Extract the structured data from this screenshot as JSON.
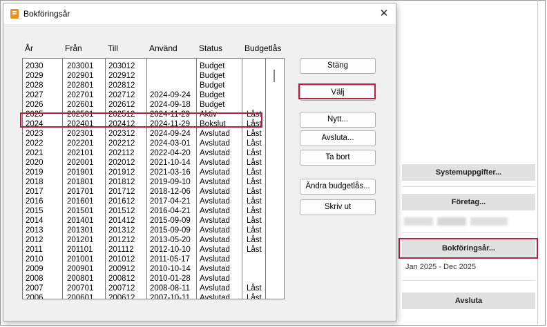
{
  "dialog": {
    "title": "Bokföringsår",
    "close_glyph": "✕"
  },
  "columns": [
    "År",
    "Från",
    "Till",
    "Använd",
    "Status",
    "Budgetlås"
  ],
  "rows": [
    {
      "year": "2030",
      "from": "203001",
      "to": "203012",
      "used": "",
      "status": "Budget",
      "lock": ""
    },
    {
      "year": "2029",
      "from": "202901",
      "to": "202912",
      "used": "",
      "status": "Budget",
      "lock": ""
    },
    {
      "year": "2028",
      "from": "202801",
      "to": "202812",
      "used": "",
      "status": "Budget",
      "lock": ""
    },
    {
      "year": "2027",
      "from": "202701",
      "to": "202712",
      "used": "2024-09-24",
      "status": "Budget",
      "lock": ""
    },
    {
      "year": "2026",
      "from": "202601",
      "to": "202612",
      "used": "2024-09-18",
      "status": "Budget",
      "lock": ""
    },
    {
      "year": "2025",
      "from": "202501",
      "to": "202512",
      "used": "2024-11-29",
      "status": "Aktiv",
      "lock": "Låst"
    },
    {
      "year": "2024",
      "from": "202401",
      "to": "202412",
      "used": "2024-11-29",
      "status": "Bokslut",
      "lock": "Låst"
    },
    {
      "year": "2023",
      "from": "202301",
      "to": "202312",
      "used": "2024-09-24",
      "status": "Avslutad",
      "lock": "Låst"
    },
    {
      "year": "2022",
      "from": "202201",
      "to": "202212",
      "used": "2024-03-01",
      "status": "Avslutad",
      "lock": "Låst"
    },
    {
      "year": "2021",
      "from": "202101",
      "to": "202112",
      "used": "2022-04-20",
      "status": "Avslutad",
      "lock": "Låst"
    },
    {
      "year": "2020",
      "from": "202001",
      "to": "202012",
      "used": "2021-10-14",
      "status": "Avslutad",
      "lock": "Låst"
    },
    {
      "year": "2019",
      "from": "201901",
      "to": "201912",
      "used": "2021-03-16",
      "status": "Avslutad",
      "lock": "Låst"
    },
    {
      "year": "2018",
      "from": "201801",
      "to": "201812",
      "used": "2019-09-10",
      "status": "Avslutad",
      "lock": "Låst"
    },
    {
      "year": "2017",
      "from": "201701",
      "to": "201712",
      "used": "2018-12-06",
      "status": "Avslutad",
      "lock": "Låst"
    },
    {
      "year": "2016",
      "from": "201601",
      "to": "201612",
      "used": "2017-04-21",
      "status": "Avslutad",
      "lock": "Låst"
    },
    {
      "year": "2015",
      "from": "201501",
      "to": "201512",
      "used": "2016-04-21",
      "status": "Avslutad",
      "lock": "Låst"
    },
    {
      "year": "2014",
      "from": "201401",
      "to": "201412",
      "used": "2015-09-09",
      "status": "Avslutad",
      "lock": "Låst"
    },
    {
      "year": "2013",
      "from": "201301",
      "to": "201312",
      "used": "2015-09-09",
      "status": "Avslutad",
      "lock": "Låst"
    },
    {
      "year": "2012",
      "from": "201201",
      "to": "201212",
      "used": "2013-05-20",
      "status": "Avslutad",
      "lock": "Låst"
    },
    {
      "year": "2011",
      "from": "201101",
      "to": "201112",
      "used": "2012-10-10",
      "status": "Avslutad",
      "lock": "Låst"
    },
    {
      "year": "2010",
      "from": "201001",
      "to": "201012",
      "used": "2011-05-17",
      "status": "Avslutad",
      "lock": ""
    },
    {
      "year": "2009",
      "from": "200901",
      "to": "200912",
      "used": "2010-10-14",
      "status": "Avslutad",
      "lock": ""
    },
    {
      "year": "2008",
      "from": "200801",
      "to": "200812",
      "used": "2010-01-28",
      "status": "Avslutad",
      "lock": ""
    },
    {
      "year": "2007",
      "from": "200701",
      "to": "200712",
      "used": "2008-08-11",
      "status": "Avslutad",
      "lock": "Låst"
    },
    {
      "year": "2006",
      "from": "200601",
      "to": "200612",
      "used": "2007-10-11",
      "status": "Avslutad",
      "lock": "Låst"
    }
  ],
  "selected_year": "2024",
  "buttons": {
    "close": "Stäng",
    "choose": "Välj",
    "new": "Nytt...",
    "finish": "Avsluta...",
    "delete": "Ta bort",
    "change_budget_lock": "Ändra budgetlås...",
    "print": "Skriv ut"
  },
  "panel": {
    "system_button": "Systemuppgifter...",
    "company_button": "Företag...",
    "fiscal_year_button": "Bokföringsår...",
    "fiscal_period": "Jan 2025  -  Dec 2025",
    "exit_button": "Avsluta"
  },
  "colors": {
    "highlight": "#b3213f",
    "app_icon": "#e8911e"
  }
}
